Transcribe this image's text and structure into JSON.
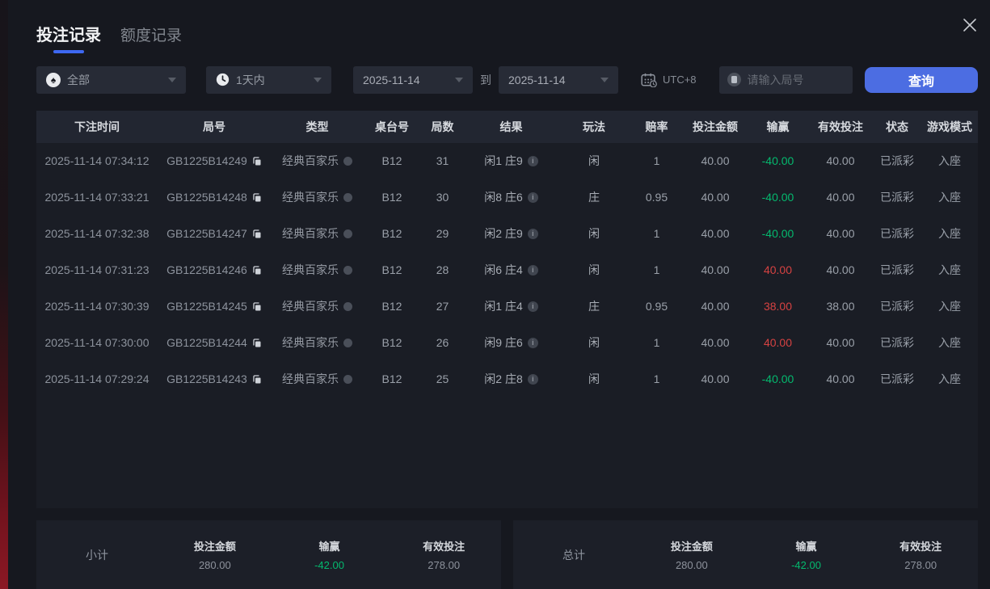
{
  "dialog": {
    "tabs": [
      {
        "label": "投注记录",
        "active": true
      },
      {
        "label": "额度记录",
        "active": false
      }
    ]
  },
  "filters": {
    "game_type": "全部",
    "time_range": "1天内",
    "date_from": "2025-11-14",
    "to_label": "到",
    "date_to": "2025-11-14",
    "timezone": "UTC+8",
    "round_input_placeholder": "请输入局号",
    "query_button": "查询"
  },
  "table": {
    "headers": [
      "下注时间",
      "局号",
      "类型",
      "桌台号",
      "局数",
      "结果",
      "玩法",
      "赔率",
      "投注金额",
      "输赢",
      "有效投注",
      "状态",
      "游戏模式"
    ],
    "rows": [
      {
        "time": "2025-11-14 07:34:12",
        "round_id": "GB1225B14249",
        "game_type": "经典百家乐",
        "table_no": "B12",
        "shoe_no": "31",
        "result": "闲1 庄9",
        "play": "闲",
        "odds": "1",
        "bet_amount": "40.00",
        "win_loss": "-40.00",
        "valid_bet": "40.00",
        "status": "已派彩",
        "mode": "入座"
      },
      {
        "time": "2025-11-14 07:33:21",
        "round_id": "GB1225B14248",
        "game_type": "经典百家乐",
        "table_no": "B12",
        "shoe_no": "30",
        "result": "闲8 庄6",
        "play": "庄",
        "odds": "0.95",
        "bet_amount": "40.00",
        "win_loss": "-40.00",
        "valid_bet": "40.00",
        "status": "已派彩",
        "mode": "入座"
      },
      {
        "time": "2025-11-14 07:32:38",
        "round_id": "GB1225B14247",
        "game_type": "经典百家乐",
        "table_no": "B12",
        "shoe_no": "29",
        "result": "闲2 庄9",
        "play": "闲",
        "odds": "1",
        "bet_amount": "40.00",
        "win_loss": "-40.00",
        "valid_bet": "40.00",
        "status": "已派彩",
        "mode": "入座"
      },
      {
        "time": "2025-11-14 07:31:23",
        "round_id": "GB1225B14246",
        "game_type": "经典百家乐",
        "table_no": "B12",
        "shoe_no": "28",
        "result": "闲6 庄4",
        "play": "闲",
        "odds": "1",
        "bet_amount": "40.00",
        "win_loss": "40.00",
        "valid_bet": "40.00",
        "status": "已派彩",
        "mode": "入座"
      },
      {
        "time": "2025-11-14 07:30:39",
        "round_id": "GB1225B14245",
        "game_type": "经典百家乐",
        "table_no": "B12",
        "shoe_no": "27",
        "result": "闲1 庄4",
        "play": "庄",
        "odds": "0.95",
        "bet_amount": "40.00",
        "win_loss": "38.00",
        "valid_bet": "38.00",
        "status": "已派彩",
        "mode": "入座"
      },
      {
        "time": "2025-11-14 07:30:00",
        "round_id": "GB1225B14244",
        "game_type": "经典百家乐",
        "table_no": "B12",
        "shoe_no": "26",
        "result": "闲9 庄6",
        "play": "闲",
        "odds": "1",
        "bet_amount": "40.00",
        "win_loss": "40.00",
        "valid_bet": "40.00",
        "status": "已派彩",
        "mode": "入座"
      },
      {
        "time": "2025-11-14 07:29:24",
        "round_id": "GB1225B14243",
        "game_type": "经典百家乐",
        "table_no": "B12",
        "shoe_no": "25",
        "result": "闲2 庄8",
        "play": "闲",
        "odds": "1",
        "bet_amount": "40.00",
        "win_loss": "-40.00",
        "valid_bet": "40.00",
        "status": "已派彩",
        "mode": "入座"
      }
    ]
  },
  "summary": {
    "labels": {
      "bet": "投注金额",
      "win": "输赢",
      "valid": "有效投注"
    },
    "subtotal": {
      "label": "小计",
      "bet_amount": "280.00",
      "win_loss": "-42.00",
      "valid_bet": "278.00"
    },
    "total": {
      "label": "总计",
      "bet_amount": "280.00",
      "win_loss": "-42.00",
      "valid_bet": "278.00"
    }
  },
  "colors": {
    "accent_blue": "#4c6de2",
    "win_red": "#d64242",
    "loss_green": "#04b96e"
  }
}
